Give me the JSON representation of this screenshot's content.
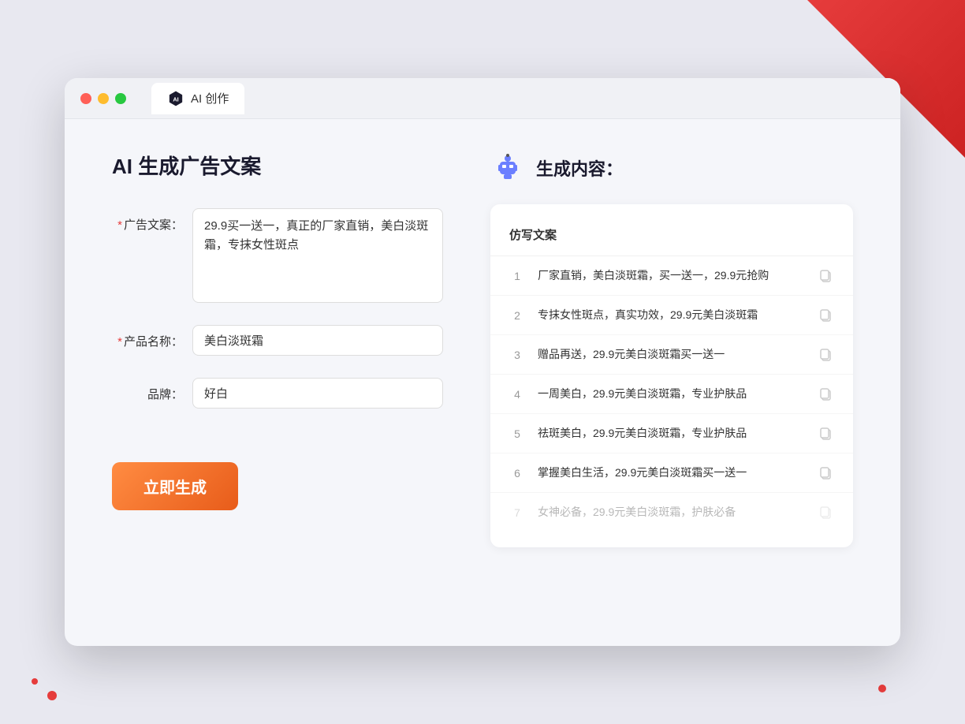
{
  "window": {
    "tab_label": "AI 创作"
  },
  "page": {
    "title": "AI 生成广告文案",
    "result_title": "生成内容："
  },
  "form": {
    "ad_copy_label": "广告文案：",
    "ad_copy_required": true,
    "ad_copy_value": "29.9买一送一，真正的厂家直销，美白淡斑霜，专抹女性斑点",
    "product_name_label": "产品名称：",
    "product_name_required": true,
    "product_name_value": "美白淡斑霜",
    "brand_label": "品牌：",
    "brand_required": false,
    "brand_value": "好白",
    "generate_btn": "立即生成"
  },
  "results": {
    "table_header": "仿写文案",
    "items": [
      {
        "num": "1",
        "text": "厂家直销，美白淡斑霜，买一送一，29.9元抢购",
        "faded": false
      },
      {
        "num": "2",
        "text": "专抹女性斑点，真实功效，29.9元美白淡斑霜",
        "faded": false
      },
      {
        "num": "3",
        "text": "赠品再送，29.9元美白淡斑霜买一送一",
        "faded": false
      },
      {
        "num": "4",
        "text": "一周美白，29.9元美白淡斑霜，专业护肤品",
        "faded": false
      },
      {
        "num": "5",
        "text": "祛斑美白，29.9元美白淡斑霜，专业护肤品",
        "faded": false
      },
      {
        "num": "6",
        "text": "掌握美白生活，29.9元美白淡斑霜买一送一",
        "faded": false
      },
      {
        "num": "7",
        "text": "女神必备，29.9元美白淡斑霜，护肤必备",
        "faded": true
      }
    ]
  }
}
